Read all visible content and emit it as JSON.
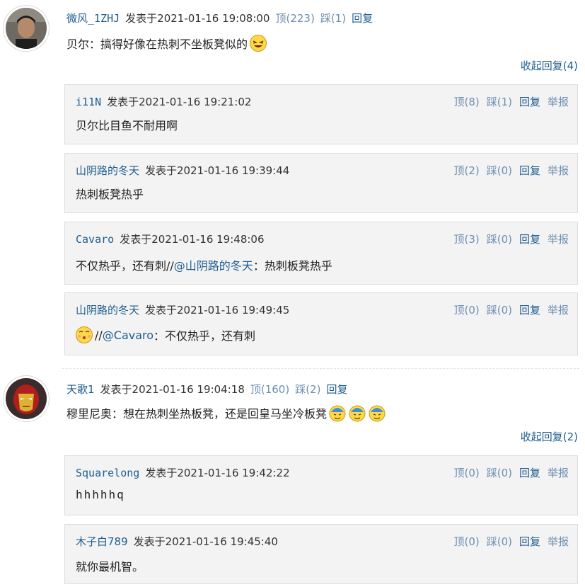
{
  "threads": [
    {
      "username": "微风_1ZHJ",
      "posted": "发表于2021-01-16 19:08:00",
      "up": "顶(223)",
      "down": "踩(1)",
      "reply": "回复",
      "text": "贝尔：搞得好像在热刺不坐板凳似的",
      "collapse": "收起回复(4)",
      "replies": [
        {
          "username": "i11N",
          "posted": "发表于2021-01-16 19:21:02",
          "up": "顶(8)",
          "down": "踩(1)",
          "reply": "回复",
          "report": "举报",
          "text": "贝尔比目鱼不耐用啊"
        },
        {
          "username": "山阴路的冬天",
          "posted": "发表于2021-01-16 19:39:44",
          "up": "顶(2)",
          "down": "踩(0)",
          "reply": "回复",
          "report": "举报",
          "text": "热刺板凳热乎"
        },
        {
          "username": "Cavaro",
          "posted": "发表于2021-01-16 19:48:06",
          "up": "顶(3)",
          "down": "踩(0)",
          "reply": "回复",
          "report": "举报",
          "text_prefix": "不仅热乎，还有刺//",
          "mention": "@山阴路的冬天",
          "text_suffix": "：热刺板凳热乎"
        },
        {
          "username": "山阴路的冬天",
          "posted": "发表于2021-01-16 19:49:45",
          "up": "顶(0)",
          "down": "踩(0)",
          "reply": "回复",
          "report": "举报",
          "text_prefix": "//",
          "mention": "@Cavaro",
          "text_suffix": "：不仅热乎，还有刺"
        }
      ]
    },
    {
      "username": "天歌1",
      "posted": "发表于2021-01-16 19:04:18",
      "up": "顶(160)",
      "down": "踩(2)",
      "reply": "回复",
      "text": "穆里尼奥：想在热刺坐热板凳，还是回皇马坐冷板凳",
      "collapse": "收起回复(2)",
      "replies": [
        {
          "username": "Squarelong",
          "posted": "发表于2021-01-16 19:42:22",
          "up": "顶(0)",
          "down": "踩(0)",
          "reply": "回复",
          "report": "举报",
          "text": "hhhhhq"
        },
        {
          "username": "木子白789",
          "posted": "发表于2021-01-16 19:45:40",
          "up": "顶(0)",
          "down": "踩(0)",
          "reply": "回复",
          "report": "举报",
          "text": "就你最机智。"
        }
      ]
    }
  ],
  "icons": {
    "avatar1": "avatar-photo",
    "avatar2": "avatar-ironman",
    "laugh": "laughing-emoji",
    "kiss": "kissing-emoji",
    "sweat": "sweat-emoji"
  },
  "colors": {
    "link": "#1f5d8f",
    "action": "#6d8fb0",
    "reply_bg": "#f3f3f3"
  }
}
